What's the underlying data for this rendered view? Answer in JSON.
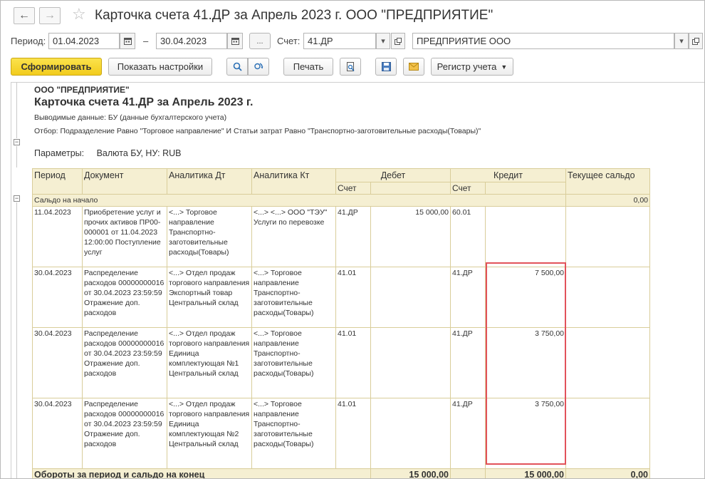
{
  "window": {
    "title": "Карточка счета 41.ДР за Апрель 2023 г. ООО \"ПРЕДПРИЯТИЕ\"",
    "back_icon": "←",
    "forward_icon": "→",
    "favorite_icon": "☆"
  },
  "filters": {
    "period_label": "Период:",
    "date_from": "01.04.2023",
    "dash": "–",
    "date_to": "30.04.2023",
    "ellipsis": "...",
    "account_label": "Счет:",
    "account": "41.ДР",
    "organization": "ПРЕДПРИЯТИЕ ООО"
  },
  "toolbar": {
    "generate": "Сформировать",
    "show_settings": "Показать настройки",
    "print": "Печать",
    "registry": "Регистр учета"
  },
  "report": {
    "company": "ООО \"ПРЕДПРИЯТИЕ\"",
    "heading": "Карточка счета 41.ДР за Апрель 2023 г.",
    "output_data": "Выводимые данные:  БУ (данные бухгалтерского учета)",
    "selection": "Отбор:  Подразделение Равно \"Торговое направление\" И Статьи затрат Равно \"Транспортно-заготовительные расходы(Товары)\"",
    "parameters_label": "Параметры:",
    "parameters_value": "Валюта БУ, НУ: RUB"
  },
  "table": {
    "headers": {
      "period": "Период",
      "document": "Документ",
      "analytics_dt": "Аналитика Дт",
      "analytics_kt": "Аналитика Кт",
      "debit": "Дебет",
      "credit": "Кредит",
      "balance": "Текущее сальдо",
      "account": "Счет"
    },
    "opening": {
      "label": "Сальдо на начало",
      "balance": "0,00"
    },
    "rows": [
      {
        "period": "11.04.2023",
        "document": "Приобретение услуг и прочих активов ПР00-000001 от 11.04.2023 12:00:00 Поступление услуг",
        "analytics_dt": "<...> Торговое направление Транспортно-заготовительные расходы(Товары)",
        "analytics_kt": "<...> <...> ООО \"ТЭУ\" Услуги по перевозке",
        "debit_account": "41.ДР",
        "debit_amount": "15 000,00",
        "credit_account": "60.01",
        "credit_amount": "",
        "balance": ""
      },
      {
        "period": "30.04.2023",
        "document": "Распределение расходов 00000000016 от 30.04.2023 23:59:59 Отражение доп. расходов",
        "analytics_dt": "<...> Отдел продаж торгового направления Экспортный товар Центральный склад",
        "analytics_kt": "<...> Торговое направление Транспортно-заготовительные расходы(Товары)",
        "debit_account": "41.01",
        "debit_amount": "",
        "credit_account": "41.ДР",
        "credit_amount": "7 500,00",
        "balance": ""
      },
      {
        "period": "30.04.2023",
        "document": "Распределение расходов 00000000016 от 30.04.2023 23:59:59 Отражение доп. расходов",
        "analytics_dt": "<...> Отдел продаж торгового направления Единица комплектующая №1 Центральный склад",
        "analytics_kt": "<...> Торговое направление Транспортно-заготовительные расходы(Товары)",
        "debit_account": "41.01",
        "debit_amount": "",
        "credit_account": "41.ДР",
        "credit_amount": "3 750,00",
        "balance": ""
      },
      {
        "period": "30.04.2023",
        "document": "Распределение расходов 00000000016 от 30.04.2023 23:59:59 Отражение доп. расходов",
        "analytics_dt": "<...> Отдел продаж торгового направления Единица комплектующая №2 Центральный склад",
        "analytics_kt": "<...> Торговое направление Транспортно-заготовительные расходы(Товары)",
        "debit_account": "41.01",
        "debit_amount": "",
        "credit_account": "41.ДР",
        "credit_amount": "3 750,00",
        "balance": ""
      }
    ],
    "totals": {
      "label": "Обороты за период и сальдо на конец",
      "debit": "15 000,00",
      "credit": "15 000,00",
      "balance": "0,00"
    }
  },
  "colors": {
    "accent": "#f2cc1d",
    "header_bg": "#f5efd2",
    "highlight": "#e2525a"
  }
}
